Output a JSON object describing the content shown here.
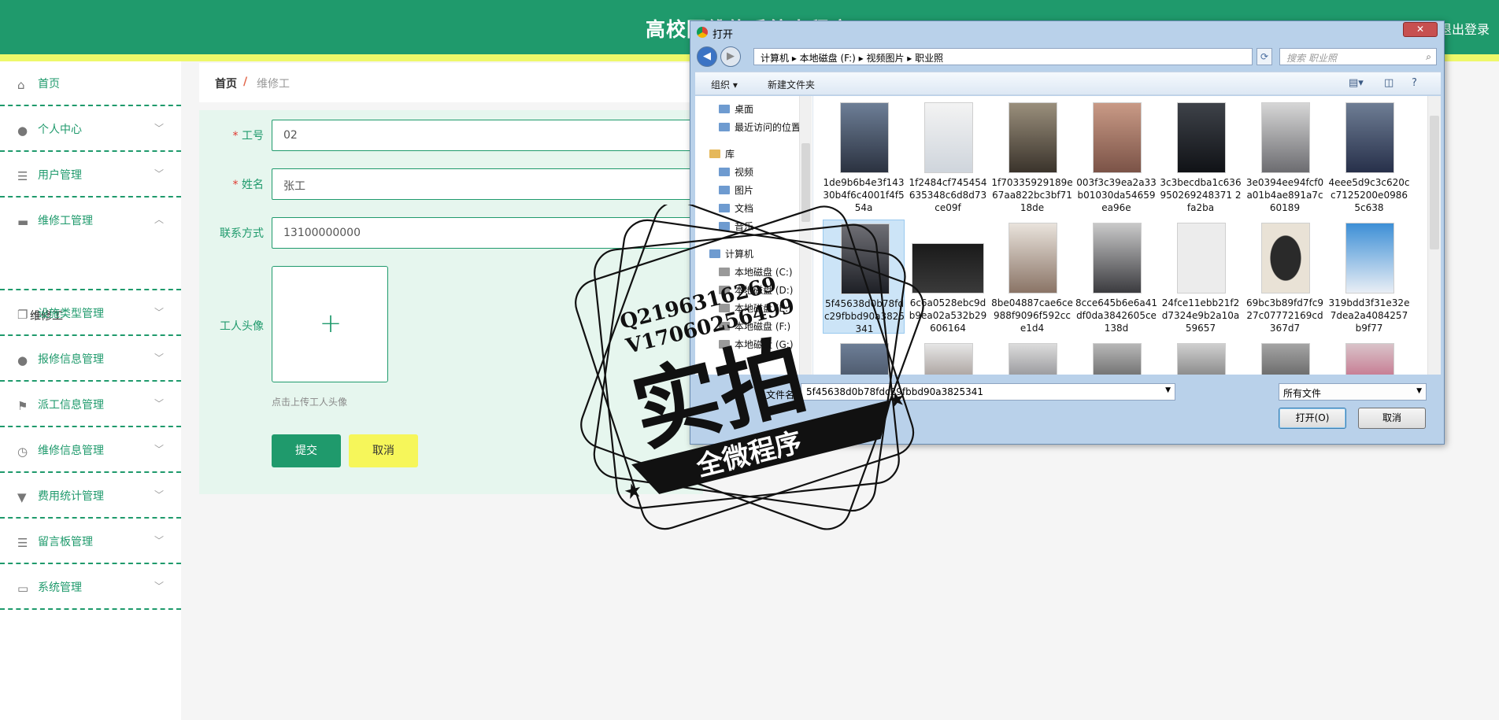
{
  "app": {
    "title": "高校园维修系统小程序",
    "logout": "退出登录"
  },
  "sidebar": {
    "items": [
      {
        "label": "首页",
        "icon": "home-icon"
      },
      {
        "label": "个人中心",
        "icon": "user-icon"
      },
      {
        "label": "用户管理",
        "icon": "list-icon"
      },
      {
        "label": "维修工管理",
        "icon": "ticket-icon",
        "expanded": true
      },
      {
        "label": "设施类型管理",
        "icon": "copy-icon"
      },
      {
        "label": "报修信息管理",
        "icon": "user-icon"
      },
      {
        "label": "派工信息管理",
        "icon": "flag-icon"
      },
      {
        "label": "维修信息管理",
        "icon": "clock-icon"
      },
      {
        "label": "费用统计管理",
        "icon": "stamp-icon"
      },
      {
        "label": "留言板管理",
        "icon": "list-icon"
      },
      {
        "label": "系统管理",
        "icon": "window-icon"
      }
    ],
    "sub_item": "维修工"
  },
  "breadcrumb": {
    "home": "首页",
    "sep": "/",
    "current": "维修工"
  },
  "form": {
    "req_mark": "*",
    "fields": [
      {
        "label": "工号",
        "value": "02",
        "required": true
      },
      {
        "label": "姓名",
        "value": "张工",
        "required": true
      },
      {
        "label": "联系方式",
        "value": "13100000000",
        "required": false
      }
    ],
    "avatar_label": "工人头像",
    "upload_plus": "+",
    "upload_hint": "点击上传工人头像",
    "submit": "提交",
    "cancel": "取消"
  },
  "dialog": {
    "title": "打开",
    "close": "✕",
    "address": "计算机 ▸ 本地磁盘 (F:) ▸ 视频图片 ▸ 职业照",
    "search_placeholder": "搜索 职业照",
    "toolbar": {
      "organize": "组织 ▾",
      "new_folder": "新建文件夹"
    },
    "nav": [
      "桌面",
      "最近访问的位置",
      "库",
      "视频",
      "图片",
      "文档",
      "音乐",
      "计算机",
      "本地磁盘 (C:)",
      "本地磁盘 (D:)",
      "本地磁盘 (E:)",
      "本地磁盘 (F:)",
      "本地磁盘 (G:)"
    ],
    "files": [
      {
        "name": "1de9b6b4e3f14330b4f6c4001f4f554a",
        "selected": false
      },
      {
        "name": "1f2484cf745454635348c6d8d73ce09f",
        "selected": false
      },
      {
        "name": "1f70335929189e67aa822bc3bf7118de",
        "selected": false
      },
      {
        "name": "003f3c39ea2a33b01030da54659ea96e",
        "selected": false
      },
      {
        "name": "3c3becdba1c636950269248371 2fa2ba",
        "selected": false
      },
      {
        "name": "3e0394ee94fcf0a01b4ae891a7c60189",
        "selected": false
      },
      {
        "name": "4eee5d9c3c620cc7125200e09865c638",
        "selected": false
      },
      {
        "name": "5f45638d0b78fdc29fbbd90a3825341",
        "selected": true
      },
      {
        "name": "6c6a0528ebc9db9ea02a532b29606164",
        "selected": false
      },
      {
        "name": "8be04887cae6ce988f9096f592cce1d4",
        "selected": false
      },
      {
        "name": "8cce645b6e6a41df0da3842605ce138d",
        "selected": false
      },
      {
        "name": "24fce11ebb21f2d7324e9b2a10a59657",
        "selected": false
      },
      {
        "name": "69bc3b89fd7fc927c07772169cd367d7",
        "selected": false
      },
      {
        "name": "319bdd3f31e32e7dea2a4084257b9f77",
        "selected": false
      }
    ],
    "filename_label": "文件名(N):",
    "filename_value": "5f45638d0b78fdc29fbbd90a3825341",
    "filetype": "所有文件",
    "open": "打开(O)",
    "cancel": "取消"
  },
  "watermark": {
    "line1": "Q2196316269",
    "line2": "V17060256499",
    "big": "实拍",
    "ribbon": "全微程序"
  },
  "colors": {
    "primary": "#1f9a6c",
    "accent_yellow": "#f6f65a",
    "required": "#e0392f"
  }
}
